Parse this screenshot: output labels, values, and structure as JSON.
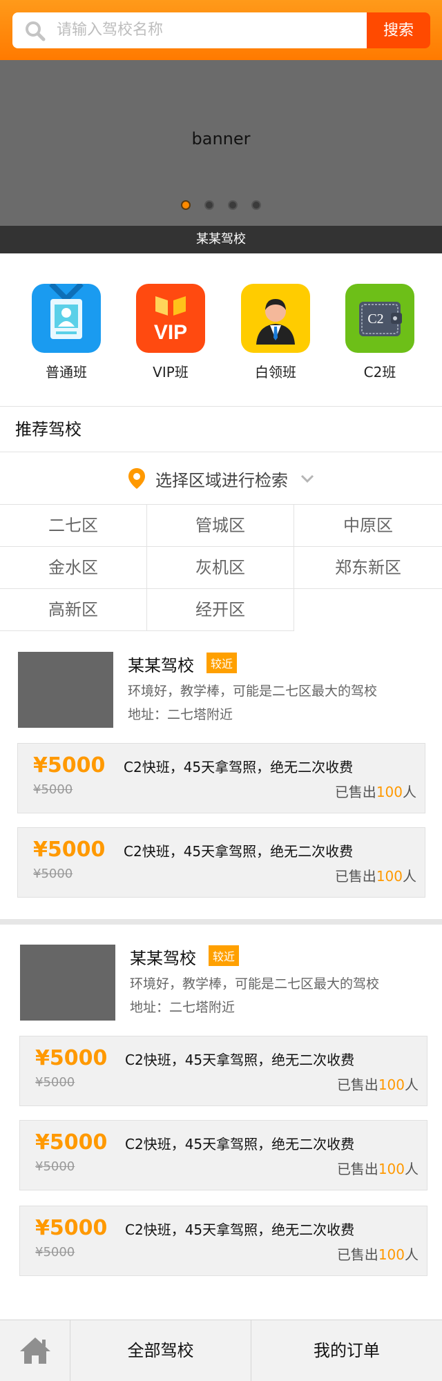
{
  "search": {
    "placeholder": "请输入驾校名称",
    "button_label": "搜索"
  },
  "banner": {
    "text": "banner",
    "caption": "某某驾校",
    "dot_count": 4,
    "active_dot": 1
  },
  "categories": [
    {
      "label": "普通班",
      "icon": "badge-icon",
      "color": "#1a9bf0"
    },
    {
      "label": "VIP班",
      "icon": "vip-icon",
      "color": "#ff4a10",
      "icon_text": "VIP"
    },
    {
      "label": "白领班",
      "icon": "businessman-icon",
      "color": "#ffcc00"
    },
    {
      "label": "C2班",
      "icon": "wallet-icon",
      "color": "#6dbf18",
      "icon_text": "C2"
    }
  ],
  "section": {
    "title": "推荐驾校"
  },
  "region_selector": {
    "label": "选择区域进行检索"
  },
  "regions": [
    "二七区",
    "管城区",
    "中原区",
    "金水区",
    "灰机区",
    "郑东新区",
    "高新区",
    "经开区"
  ],
  "schools": [
    {
      "name": "某某驾校",
      "badge": "较近",
      "description": "环境好，教学棒，可能是二七区最大的驾校",
      "address": "地址：二七塔附近",
      "courses": [
        {
          "price": "¥5000",
          "original_price": "¥5000",
          "title": "C2快班，45天拿驾照，绝无二次收费",
          "sold_prefix": "已售出",
          "sold_count": "100",
          "sold_suffix": "人"
        },
        {
          "price": "¥5000",
          "original_price": "¥5000",
          "title": "C2快班，45天拿驾照，绝无二次收费",
          "sold_prefix": "已售出",
          "sold_count": "100",
          "sold_suffix": "人"
        }
      ]
    },
    {
      "name": "某某驾校",
      "badge": "较近",
      "description": "环境好，教学棒，可能是二七区最大的驾校",
      "address": "地址：二七塔附近",
      "courses": [
        {
          "price": "¥5000",
          "original_price": "¥5000",
          "title": "C2快班，45天拿驾照，绝无二次收费",
          "sold_prefix": "已售出",
          "sold_count": "100",
          "sold_suffix": "人"
        },
        {
          "price": "¥5000",
          "original_price": "¥5000",
          "title": "C2快班，45天拿驾照，绝无二次收费",
          "sold_prefix": "已售出",
          "sold_count": "100",
          "sold_suffix": "人"
        },
        {
          "price": "¥5000",
          "original_price": "¥5000",
          "title": "C2快班，45天拿驾照，绝无二次收费",
          "sold_prefix": "已售出",
          "sold_count": "100",
          "sold_suffix": "人"
        }
      ]
    }
  ],
  "bottom_nav": {
    "home_icon": "home-icon",
    "all_schools": "全部驾校",
    "my_orders": "我的订单"
  },
  "colors": {
    "accent": "#ff8a00",
    "search_button": "#ff4a00",
    "price": "#ff9900"
  }
}
